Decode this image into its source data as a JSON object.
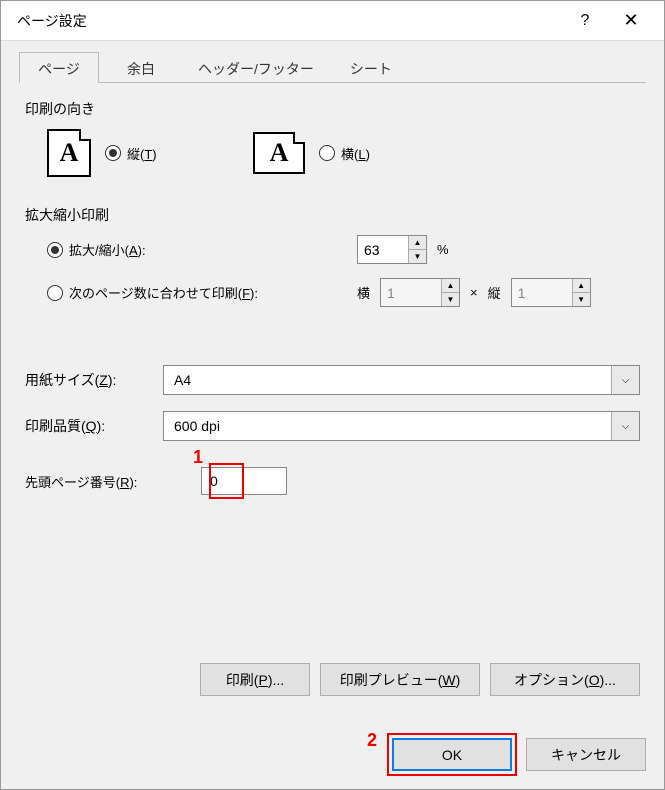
{
  "titlebar": {
    "title": "ページ設定"
  },
  "tabs": [
    {
      "label": "ページ",
      "active": true
    },
    {
      "label": "余白"
    },
    {
      "label": "ヘッダー/フッター"
    },
    {
      "label": "シート"
    }
  ],
  "orientation": {
    "group_label": "印刷の向き",
    "portrait_label": "縦(T)",
    "landscape_label": "横(L)",
    "selected": "portrait"
  },
  "scaling": {
    "group_label": "拡大縮小印刷",
    "adjust_label": "拡大/縮小(A):",
    "adjust_value": "63",
    "percent": "%",
    "fit_label": "次のページ数に合わせて印刷(F):",
    "fit_wide_label": "横",
    "fit_wide_value": "1",
    "times": "×",
    "fit_tall_label": "縦",
    "fit_tall_value": "1",
    "selected": "adjust"
  },
  "paper": {
    "size_label": "用紙サイズ(Z):",
    "size_value": "A4",
    "quality_label": "印刷品質(Q):",
    "quality_value": "600 dpi"
  },
  "first_page": {
    "label": "先頭ページ番号(R):",
    "value": "0"
  },
  "buttons": {
    "print": "印刷(P)...",
    "preview": "印刷プレビュー(W)",
    "options": "オプション(O)..."
  },
  "footer": {
    "ok": "OK",
    "cancel": "キャンセル"
  },
  "annotations": {
    "a1": "1",
    "a2": "2"
  }
}
